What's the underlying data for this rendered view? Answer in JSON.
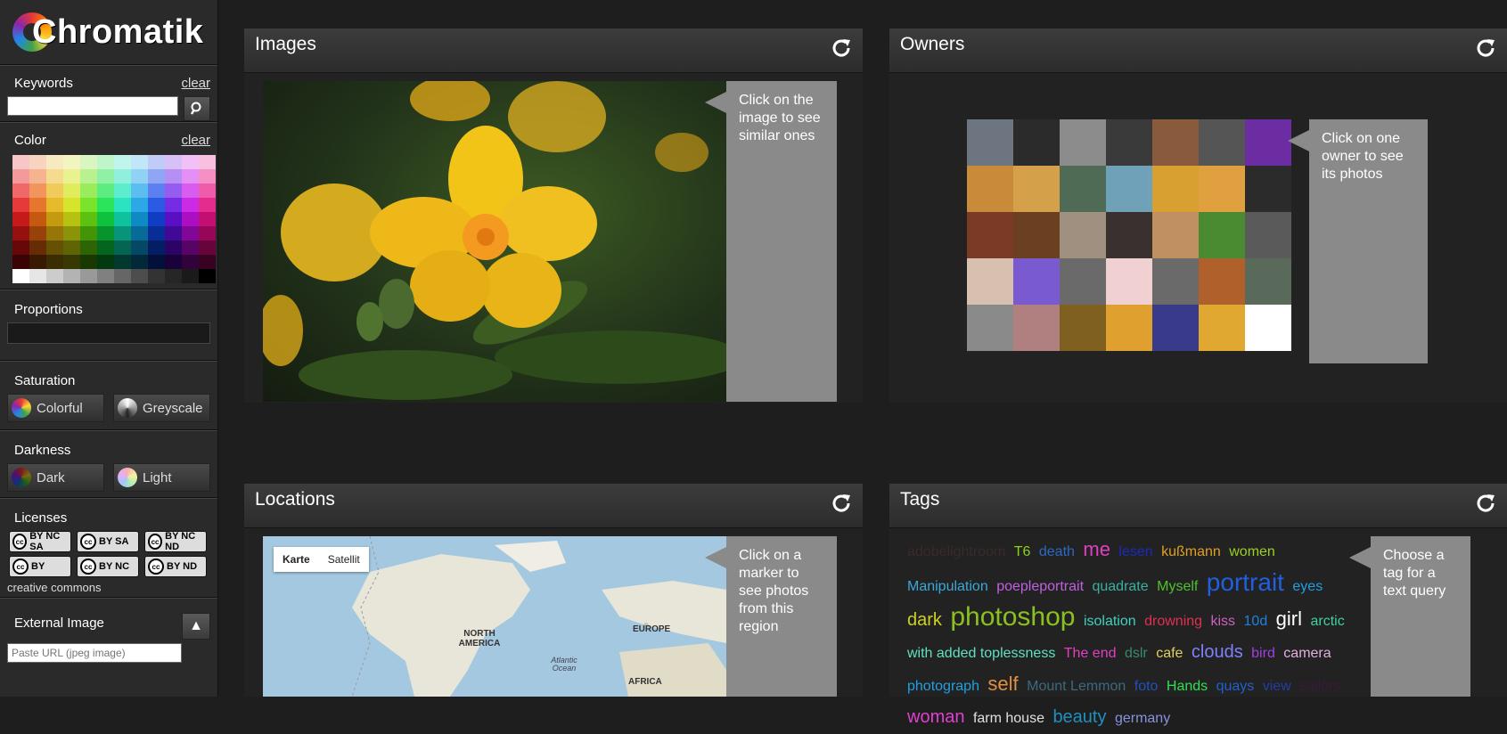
{
  "app": {
    "name": "Chromatik"
  },
  "sidebar": {
    "keywords": {
      "label": "Keywords",
      "clear": "clear",
      "input_value": "",
      "placeholder": ""
    },
    "color": {
      "label": "Color",
      "clear": "clear"
    },
    "proportions": {
      "label": "Proportions"
    },
    "saturation": {
      "label": "Saturation",
      "buttons": [
        "Colorful",
        "Greyscale"
      ]
    },
    "darkness": {
      "label": "Darkness",
      "buttons": [
        "Dark",
        "Light"
      ]
    },
    "licenses": {
      "label": "Licenses",
      "footer": "creative commons",
      "badges": [
        "BY NC SA",
        "BY SA",
        "BY NC ND",
        "BY",
        "BY NC",
        "BY ND"
      ]
    },
    "external_image": {
      "label": "External Image",
      "placeholder": "Paste URL (jpeg image)"
    }
  },
  "colors": {
    "palette_rows": [
      [
        "#f7c6c6",
        "#f7d3c0",
        "#f7e9c0",
        "#f2f5c0",
        "#d9f5c0",
        "#c0f5cc",
        "#c0f5ec",
        "#c0e6f7",
        "#c0ccf7",
        "#d6c0f7",
        "#f0c0f7",
        "#f7c0df"
      ],
      [
        "#f59a9a",
        "#f5b48f",
        "#f5da8f",
        "#eaf18f",
        "#baf18f",
        "#8ff1a6",
        "#8ff1dc",
        "#8fd2f5",
        "#8fa6f5",
        "#b68ff5",
        "#e48ff5",
        "#f58fc4"
      ],
      [
        "#f06868",
        "#f0955c",
        "#f0cb5c",
        "#e1ec5c",
        "#9aec5c",
        "#5cec80",
        "#5cecce",
        "#5cbef0",
        "#5c80f0",
        "#965cf0",
        "#d85cf0",
        "#f05caa"
      ],
      [
        "#e53a3a",
        "#e5762b",
        "#e5bb2b",
        "#d6e42b",
        "#7ae42b",
        "#2be45b",
        "#2be4bf",
        "#2ba8e5",
        "#2b5be5",
        "#762be5",
        "#cb2be5",
        "#e52b8e"
      ],
      [
        "#c41a1a",
        "#c4590f",
        "#c49b0f",
        "#b6c20f",
        "#5cc20f",
        "#0fc23d",
        "#0fc29f",
        "#0f8bc4",
        "#0f3dc4",
        "#590fc4",
        "#aa0fc4",
        "#c40f72"
      ],
      [
        "#961010",
        "#964208",
        "#967608",
        "#8b9408",
        "#449408",
        "#08942d",
        "#08947a",
        "#086a96",
        "#082d96",
        "#420896",
        "#810896",
        "#960857"
      ],
      [
        "#660808",
        "#662c04",
        "#665004",
        "#5f6504",
        "#2e6504",
        "#04651e",
        "#046553",
        "#044866",
        "#041e66",
        "#2c0466",
        "#580466",
        "#66043b"
      ],
      [
        "#3a0404",
        "#3a1902",
        "#3a2d02",
        "#363902",
        "#1a3902",
        "#023911",
        "#02392f",
        "#02293a",
        "#02113a",
        "#19023a",
        "#32023a",
        "#3a0222"
      ],
      [
        "#ffffff",
        "#e6e6e6",
        "#cccccc",
        "#b3b3b3",
        "#999999",
        "#808080",
        "#666666",
        "#4d4d4d",
        "#333333",
        "#262626",
        "#1a1a1a",
        "#000000"
      ]
    ],
    "owner_cells": [
      [
        "#6d7680",
        "#2b2b2b",
        "#8c8c8c",
        "#3a3a3a",
        "#8a5a3c",
        "#555555",
        "#6b2da1"
      ],
      [
        "#c98a3a",
        "#d4a04a",
        "#4f6b55",
        "#6fa1b8",
        "#d8a030",
        "#e0a040",
        "#2b2b2b"
      ],
      [
        "#7a3a25",
        "#6a4020",
        "#a09080",
        "#3a3030",
        "#c09060",
        "#4a8a30",
        "#5a5a5a"
      ],
      [
        "#d8c0b0",
        "#7a5ad0",
        "#6a6a6a",
        "#f0d0d0",
        "#6a6a6a",
        "#b0602a",
        "#5a6a5a"
      ],
      [
        "#8a8a8a",
        "#b08080",
        "#806020",
        "#e0a030",
        "#3a3a8a",
        "#e0a830",
        "#ffffff"
      ]
    ]
  },
  "panels": {
    "images": {
      "title": "Images",
      "callout": "Click on the image to see similar ones"
    },
    "owners": {
      "title": "Owners",
      "callout": "Click on one owner to see its photos"
    },
    "locations": {
      "title": "Locations",
      "callout": "Click on a marker to see photos from this region",
      "map_types": [
        "Karte",
        "Satellit"
      ],
      "labels": {
        "north_america": "NORTH AMERICA",
        "europe": "EUROPE",
        "africa": "AFRICA",
        "atlantic": "Atlantic Ocean"
      }
    },
    "tags": {
      "title": "Tags",
      "callout": "Choose a tag for a text query"
    }
  },
  "tags": [
    {
      "text": "adobelightroom",
      "color": "#3a2a2a",
      "size": 16
    },
    {
      "text": "T6",
      "color": "#8bd11a",
      "size": 16
    },
    {
      "text": "death",
      "color": "#2a6ac0",
      "size": 16
    },
    {
      "text": "me",
      "color": "#e040c0",
      "size": 22
    },
    {
      "text": "lesen",
      "color": "#1a2ac0",
      "size": 16
    },
    {
      "text": "kußmann",
      "color": "#e0a020",
      "size": 16
    },
    {
      "text": "women",
      "color": "#9ad020",
      "size": 16
    },
    {
      "text": "Manipulation",
      "color": "#3aa8d8",
      "size": 16
    },
    {
      "text": "poepleportrait",
      "color": "#c060e0",
      "size": 16
    },
    {
      "text": "quadrate",
      "color": "#3ab0a0",
      "size": 16
    },
    {
      "text": "Myself",
      "color": "#50c030",
      "size": 16
    },
    {
      "text": "portrait",
      "color": "#2060e0",
      "size": 28
    },
    {
      "text": "eyes",
      "color": "#20a0e0",
      "size": 16
    },
    {
      "text": "dark",
      "color": "#d0d020",
      "size": 20
    },
    {
      "text": "photoshop",
      "color": "#8ac020",
      "size": 30
    },
    {
      "text": "isolation",
      "color": "#40d0c0",
      "size": 16
    },
    {
      "text": "drowning",
      "color": "#e03050",
      "size": 16
    },
    {
      "text": "kiss",
      "color": "#d060c0",
      "size": 16
    },
    {
      "text": "10d",
      "color": "#2080e0",
      "size": 16
    },
    {
      "text": "girl",
      "color": "#ffffff",
      "size": 22
    },
    {
      "text": "arctic",
      "color": "#40d0a0",
      "size": 16
    },
    {
      "text": "with added toplessness",
      "color": "#60e0c0",
      "size": 16
    },
    {
      "text": "The end",
      "color": "#e040c0",
      "size": 16
    },
    {
      "text": "dslr",
      "color": "#3a8a6a",
      "size": 16
    },
    {
      "text": "cafe",
      "color": "#e0d060",
      "size": 16
    },
    {
      "text": "clouds",
      "color": "#8080ff",
      "size": 20
    },
    {
      "text": "bird",
      "color": "#a040e0",
      "size": 16
    },
    {
      "text": "camera",
      "color": "#e0b0e0",
      "size": 16
    },
    {
      "text": "photograph",
      "color": "#20a0e0",
      "size": 16
    },
    {
      "text": "self",
      "color": "#e09040",
      "size": 22
    },
    {
      "text": "Mount Lemmon",
      "color": "#3a6a80",
      "size": 16
    },
    {
      "text": "foto",
      "color": "#2050c0",
      "size": 16
    },
    {
      "text": "Hands",
      "color": "#30e050",
      "size": 16
    },
    {
      "text": "quays",
      "color": "#2060d0",
      "size": 16
    },
    {
      "text": "view",
      "color": "#2040a0",
      "size": 16
    },
    {
      "text": "sailors",
      "color": "#3a1a3a",
      "size": 16
    },
    {
      "text": "woman",
      "color": "#e040d0",
      "size": 20
    },
    {
      "text": "farm house",
      "color": "#e0e0e0",
      "size": 16
    },
    {
      "text": "beauty",
      "color": "#2090c0",
      "size": 20
    },
    {
      "text": "germany",
      "color": "#8a90e0",
      "size": 16
    }
  ]
}
